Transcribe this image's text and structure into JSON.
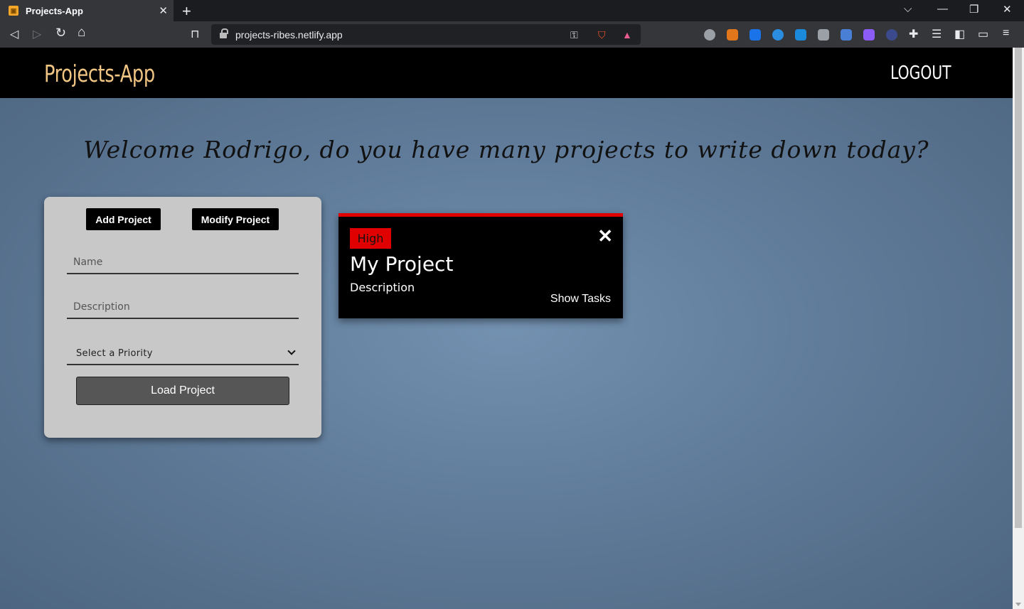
{
  "browser": {
    "tab_title": "Projects-App",
    "tab_close": "✕",
    "new_tab": "+",
    "url": "projects-ribes.netlify.app",
    "window_controls": {
      "dropdown": "⌵",
      "minimize": "—",
      "restore": "❐",
      "close": "✕"
    },
    "nav": {
      "back": "◁",
      "forward": "▷",
      "reload": "↻",
      "home": "⌂",
      "bookmark": "⊓"
    },
    "extension_colors": [
      "#9aa0a6",
      "#e2761b",
      "#1a73e8",
      "#2b8de0",
      "#1c8adb",
      "#9aa0a6",
      "#4a7fd6",
      "#8b5cf6",
      "#3b4a8c"
    ]
  },
  "app": {
    "brand": "Projects-App",
    "logout": "LOGOUT",
    "welcome": "Welcome Rodrigo, do you have many projects to write down today?"
  },
  "form": {
    "add_project_label": "Add Project",
    "modify_project_label": "Modify Project",
    "name_placeholder": "Name",
    "description_placeholder": "Description",
    "priority_selected": "Select a Priority",
    "load_label": "Load Project"
  },
  "project_card": {
    "priority": "High",
    "priority_color": "#e00000",
    "close": "✕",
    "title": "My Project",
    "description": "Description",
    "show_tasks": "Show Tasks"
  }
}
